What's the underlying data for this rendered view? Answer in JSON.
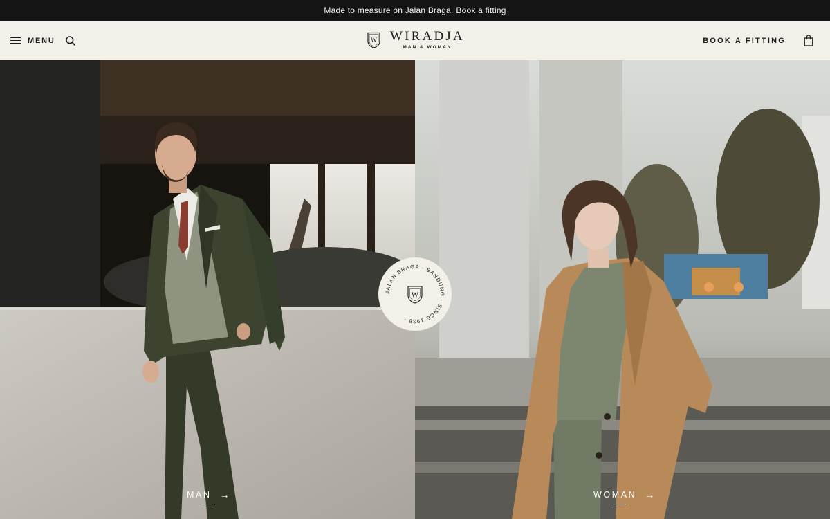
{
  "announcement": {
    "text": "Made to measure on Jalan Braga.",
    "link": "Book a fitting"
  },
  "header": {
    "menu_label": "MENU",
    "brand": "WIRADJA",
    "tagline": "MAN & WOMAN",
    "logo_initial": "W",
    "book_fitting": "BOOK A FITTING",
    "icons": [
      "hamburger-icon",
      "search-icon",
      "shield-logo-icon",
      "shopping-bag-icon"
    ]
  },
  "hero": {
    "man_label": "MAN",
    "woman_label": "WOMAN",
    "arrow": "→",
    "badge": {
      "ring_text": "JALAN BRAGA · BANDUNG · SINCE 1938 ·",
      "initial": "W"
    }
  },
  "colors": {
    "announcement_bg": "#141414",
    "header_bg": "#f3f0ea",
    "text": "#1b1b1b",
    "suit": "#3c4430",
    "coat": "#b88a5a"
  }
}
